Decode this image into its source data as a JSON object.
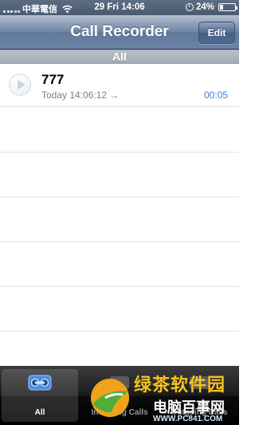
{
  "status_bar": {
    "carrier": "中華電信",
    "time": "29 Fri 14:06",
    "battery": "24%",
    "battery_level": 0.24
  },
  "nav": {
    "title": "Call Recorder",
    "edit_label": "Edit"
  },
  "section": {
    "title": "All"
  },
  "recordings": [
    {
      "number": "777",
      "timestamp": "Today 14:06:12 →",
      "duration": "00:05"
    }
  ],
  "tabs": [
    {
      "label": "All",
      "icon": "tape-icon",
      "active": true
    },
    {
      "label": "Incoming Calls",
      "icon": "incoming-icon",
      "active": false
    },
    {
      "label": "Outgoing Calls",
      "icon": "outgoing-icon",
      "active": false
    }
  ],
  "watermark": {
    "brand_cn": "绿茶软件园",
    "brand_cn2": "电脑百事网",
    "url": "WWW.PC841.COM"
  },
  "colors": {
    "nav_blue": "#6d84a2",
    "duration_blue": "#3b7fe0",
    "tab_bar": "#000000",
    "watermark_yellow": "#f6c21a"
  }
}
